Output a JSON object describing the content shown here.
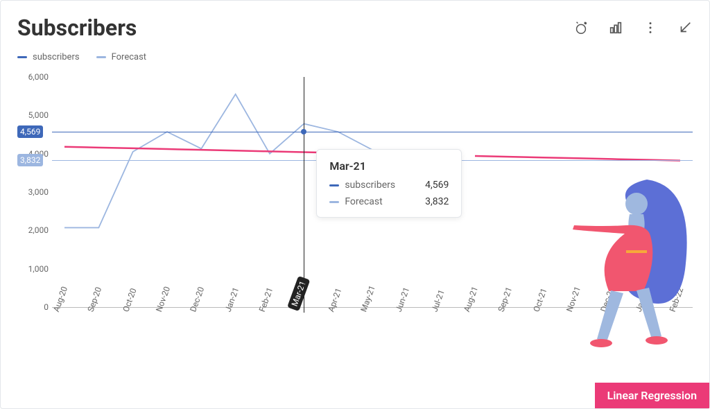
{
  "title": "Subscribers",
  "legend": {
    "subscribers": {
      "label": "subscribers",
      "color": "#3e68b9"
    },
    "forecast": {
      "label": "Forecast",
      "color": "#9cb6e0"
    }
  },
  "toolbar_icons": [
    "alerts",
    "chart-type",
    "more",
    "collapse"
  ],
  "tooltip": {
    "title": "Mar-21",
    "rows": {
      "subscribers": {
        "label": "subscribers",
        "value": "4,569"
      },
      "forecast": {
        "label": "Forecast",
        "value": "3,832"
      }
    }
  },
  "value_badges": {
    "subscribers": "4,569",
    "forecast": "3,832"
  },
  "button": "Linear Regression",
  "chart_data": {
    "type": "line",
    "xlabel": "",
    "ylabel": "",
    "ylim": [
      0,
      6000
    ],
    "categories": [
      "Aug-20",
      "Sep-20",
      "Oct-20",
      "Nov-20",
      "Dec-20",
      "Jan-21",
      "Feb-21",
      "Mar-21",
      "Apr-21",
      "May-21",
      "Jun-21",
      "Jul-21",
      "Aug-21",
      "Sep-21",
      "Oct-21",
      "Nov-21",
      "Dec-21",
      "Jan-22",
      "Feb-22"
    ],
    "y_ticks": [
      0,
      1000,
      2000,
      3000,
      4000,
      5000,
      6000
    ],
    "y_tick_labels": [
      "0",
      "1,000",
      "2,000",
      "3,000",
      "4,000",
      "5,000",
      "6,000"
    ],
    "highlight_index": 7,
    "series": [
      {
        "name": "subscribers",
        "color": "#3e68b9",
        "values": [
          null,
          null,
          null,
          null,
          null,
          null,
          null,
          4569,
          null,
          null,
          null,
          null,
          null,
          null,
          null,
          null,
          null,
          null,
          null
        ]
      },
      {
        "name": "forecast",
        "color": "#9cb6e0",
        "values": [
          2070,
          2070,
          4050,
          4570,
          4130,
          5550,
          4000,
          4780,
          4569,
          4100,
          null,
          null,
          null,
          null,
          null,
          null,
          null,
          null,
          null
        ]
      },
      {
        "name": "regression",
        "color": "#eb3a77",
        "values": [
          4180,
          4160,
          4140,
          4120,
          4100,
          4080,
          4060,
          4040,
          4020,
          null,
          null,
          null,
          3940,
          3920,
          3900,
          3880,
          3860,
          3840,
          3820
        ]
      }
    ],
    "highlight_values": {
      "subscribers": 4569,
      "forecast": 3832
    }
  }
}
